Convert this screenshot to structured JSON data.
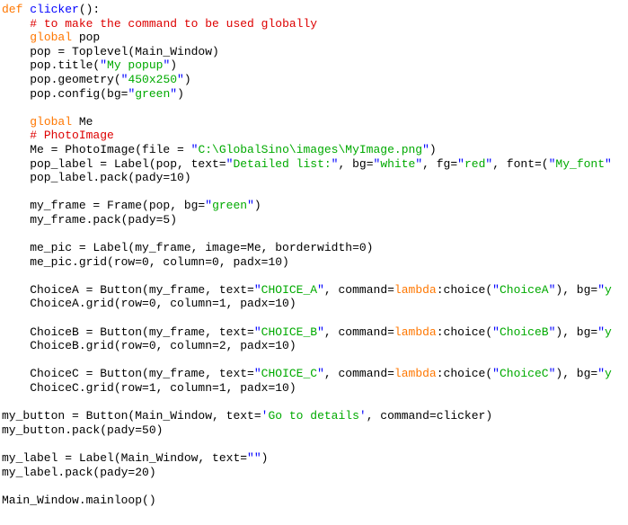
{
  "editor": {
    "language": "Python",
    "background_color": "#ffffff",
    "font_size_px": 13,
    "line_height_px": 15.6,
    "colors": {
      "keyword": "#ff7700",
      "function_name": "#0000ff",
      "comment": "#dd0000",
      "string": "#00aa00",
      "quote": "#0000ff",
      "plain_text": "#000000"
    }
  },
  "lines": [
    {
      "n": 1,
      "segments": [
        {
          "t": "def ",
          "c": "kw"
        },
        {
          "t": "clicker",
          "c": "def"
        },
        {
          "t": "():",
          "c": "plain"
        }
      ]
    },
    {
      "n": 2,
      "segments": [
        {
          "t": "    ",
          "c": "plain"
        },
        {
          "t": "# to make the command to be used globally",
          "c": "comment"
        }
      ]
    },
    {
      "n": 3,
      "segments": [
        {
          "t": "    ",
          "c": "plain"
        },
        {
          "t": "global",
          "c": "kw"
        },
        {
          "t": " pop",
          "c": "plain"
        }
      ]
    },
    {
      "n": 4,
      "segments": [
        {
          "t": "    pop = Toplevel(Main_Window)",
          "c": "plain"
        }
      ]
    },
    {
      "n": 5,
      "segments": [
        {
          "t": "    pop.title(",
          "c": "plain"
        },
        {
          "t": "\"",
          "c": "quote"
        },
        {
          "t": "My popup",
          "c": "str"
        },
        {
          "t": "\"",
          "c": "quote"
        },
        {
          "t": ")",
          "c": "plain"
        }
      ]
    },
    {
      "n": 6,
      "segments": [
        {
          "t": "    pop.geometry(",
          "c": "plain"
        },
        {
          "t": "\"",
          "c": "quote"
        },
        {
          "t": "450x250",
          "c": "str"
        },
        {
          "t": "\"",
          "c": "quote"
        },
        {
          "t": ")",
          "c": "plain"
        }
      ]
    },
    {
      "n": 7,
      "segments": [
        {
          "t": "    pop.config(bg=",
          "c": "plain"
        },
        {
          "t": "\"",
          "c": "quote"
        },
        {
          "t": "green",
          "c": "str"
        },
        {
          "t": "\"",
          "c": "quote"
        },
        {
          "t": ")",
          "c": "plain"
        }
      ]
    },
    {
      "n": 8,
      "segments": []
    },
    {
      "n": 9,
      "segments": [
        {
          "t": "    ",
          "c": "plain"
        },
        {
          "t": "global",
          "c": "kw"
        },
        {
          "t": " Me",
          "c": "plain"
        }
      ]
    },
    {
      "n": 10,
      "segments": [
        {
          "t": "    ",
          "c": "plain"
        },
        {
          "t": "# PhotoImage",
          "c": "comment"
        }
      ]
    },
    {
      "n": 11,
      "segments": [
        {
          "t": "    Me = PhotoImage(file = ",
          "c": "plain"
        },
        {
          "t": "\"",
          "c": "quote"
        },
        {
          "t": "C:\\GlobalSino\\images\\MyImage.png",
          "c": "str"
        },
        {
          "t": "\"",
          "c": "quote"
        },
        {
          "t": ")",
          "c": "plain"
        }
      ]
    },
    {
      "n": 12,
      "segments": [
        {
          "t": "    pop_label = Label(pop, text=",
          "c": "plain"
        },
        {
          "t": "\"",
          "c": "quote"
        },
        {
          "t": "Detailed list:",
          "c": "str"
        },
        {
          "t": "\"",
          "c": "quote"
        },
        {
          "t": ", bg=",
          "c": "plain"
        },
        {
          "t": "\"",
          "c": "quote"
        },
        {
          "t": "white",
          "c": "str"
        },
        {
          "t": "\"",
          "c": "quote"
        },
        {
          "t": ", fg=",
          "c": "plain"
        },
        {
          "t": "\"",
          "c": "quote"
        },
        {
          "t": "red",
          "c": "str"
        },
        {
          "t": "\"",
          "c": "quote"
        },
        {
          "t": ", font=(",
          "c": "plain"
        },
        {
          "t": "\"",
          "c": "quote"
        },
        {
          "t": "My_font",
          "c": "str"
        },
        {
          "t": "\"",
          "c": "quote"
        }
      ]
    },
    {
      "n": 13,
      "segments": [
        {
          "t": "    pop_label.pack(pady=10)",
          "c": "plain"
        }
      ]
    },
    {
      "n": 14,
      "segments": []
    },
    {
      "n": 15,
      "segments": [
        {
          "t": "    my_frame = Frame(pop, bg=",
          "c": "plain"
        },
        {
          "t": "\"",
          "c": "quote"
        },
        {
          "t": "green",
          "c": "str"
        },
        {
          "t": "\"",
          "c": "quote"
        },
        {
          "t": ")",
          "c": "plain"
        }
      ]
    },
    {
      "n": 16,
      "segments": [
        {
          "t": "    my_frame.pack(pady=5)",
          "c": "plain"
        }
      ]
    },
    {
      "n": 17,
      "segments": []
    },
    {
      "n": 18,
      "segments": [
        {
          "t": "    me_pic = Label(my_frame, image=Me, borderwidth=0)",
          "c": "plain"
        }
      ]
    },
    {
      "n": 19,
      "segments": [
        {
          "t": "    me_pic.grid(row=0, column=0, padx=10)",
          "c": "plain"
        }
      ]
    },
    {
      "n": 20,
      "segments": []
    },
    {
      "n": 21,
      "segments": [
        {
          "t": "    ChoiceA = Button(my_frame, text=",
          "c": "plain"
        },
        {
          "t": "\"",
          "c": "quote"
        },
        {
          "t": "CHOICE_A",
          "c": "str"
        },
        {
          "t": "\"",
          "c": "quote"
        },
        {
          "t": ", command=",
          "c": "plain"
        },
        {
          "t": "lambda",
          "c": "kw"
        },
        {
          "t": ":choice(",
          "c": "plain"
        },
        {
          "t": "\"",
          "c": "quote"
        },
        {
          "t": "ChoiceA",
          "c": "str"
        },
        {
          "t": "\"",
          "c": "quote"
        },
        {
          "t": "), bg=",
          "c": "plain"
        },
        {
          "t": "\"",
          "c": "quote"
        },
        {
          "t": "y",
          "c": "str"
        }
      ]
    },
    {
      "n": 22,
      "segments": [
        {
          "t": "    ChoiceA.grid(row=0, column=1, padx=10)",
          "c": "plain"
        }
      ]
    },
    {
      "n": 23,
      "segments": []
    },
    {
      "n": 24,
      "segments": [
        {
          "t": "    ChoiceB = Button(my_frame, text=",
          "c": "plain"
        },
        {
          "t": "\"",
          "c": "quote"
        },
        {
          "t": "CHOICE_B",
          "c": "str"
        },
        {
          "t": "\"",
          "c": "quote"
        },
        {
          "t": ", command=",
          "c": "plain"
        },
        {
          "t": "lambda",
          "c": "kw"
        },
        {
          "t": ":choice(",
          "c": "plain"
        },
        {
          "t": "\"",
          "c": "quote"
        },
        {
          "t": "ChoiceB",
          "c": "str"
        },
        {
          "t": "\"",
          "c": "quote"
        },
        {
          "t": "), bg=",
          "c": "plain"
        },
        {
          "t": "\"",
          "c": "quote"
        },
        {
          "t": "y",
          "c": "str"
        }
      ]
    },
    {
      "n": 25,
      "segments": [
        {
          "t": "    ChoiceB.grid(row=0, column=2, padx=10)",
          "c": "plain"
        }
      ]
    },
    {
      "n": 26,
      "segments": []
    },
    {
      "n": 27,
      "segments": [
        {
          "t": "    ChoiceC = Button(my_frame, text=",
          "c": "plain"
        },
        {
          "t": "\"",
          "c": "quote"
        },
        {
          "t": "CHOICE_C",
          "c": "str"
        },
        {
          "t": "\"",
          "c": "quote"
        },
        {
          "t": ", command=",
          "c": "plain"
        },
        {
          "t": "lambda",
          "c": "kw"
        },
        {
          "t": ":choice(",
          "c": "plain"
        },
        {
          "t": "\"",
          "c": "quote"
        },
        {
          "t": "ChoiceC",
          "c": "str"
        },
        {
          "t": "\"",
          "c": "quote"
        },
        {
          "t": "), bg=",
          "c": "plain"
        },
        {
          "t": "\"",
          "c": "quote"
        },
        {
          "t": "y",
          "c": "str"
        }
      ]
    },
    {
      "n": 28,
      "segments": [
        {
          "t": "    ChoiceC.grid(row=1, column=1, padx=10)",
          "c": "plain"
        }
      ]
    },
    {
      "n": 29,
      "segments": []
    },
    {
      "n": 30,
      "segments": [
        {
          "t": "my_button = Button(Main_Window, text=",
          "c": "plain"
        },
        {
          "t": "'",
          "c": "quote"
        },
        {
          "t": "Go to details",
          "c": "str"
        },
        {
          "t": "'",
          "c": "quote"
        },
        {
          "t": ", command=clicker)",
          "c": "plain"
        }
      ]
    },
    {
      "n": 31,
      "segments": [
        {
          "t": "my_button.pack(pady=50)",
          "c": "plain"
        }
      ]
    },
    {
      "n": 32,
      "segments": []
    },
    {
      "n": 33,
      "segments": [
        {
          "t": "my_label = Label(Main_Window, text=",
          "c": "plain"
        },
        {
          "t": "\"\"",
          "c": "quote"
        },
        {
          "t": ")",
          "c": "plain"
        }
      ]
    },
    {
      "n": 34,
      "segments": [
        {
          "t": "my_label.pack(pady=20)",
          "c": "plain"
        }
      ]
    },
    {
      "n": 35,
      "segments": []
    },
    {
      "n": 36,
      "segments": [
        {
          "t": "Main_Window.mainloop()",
          "c": "plain"
        }
      ]
    }
  ]
}
